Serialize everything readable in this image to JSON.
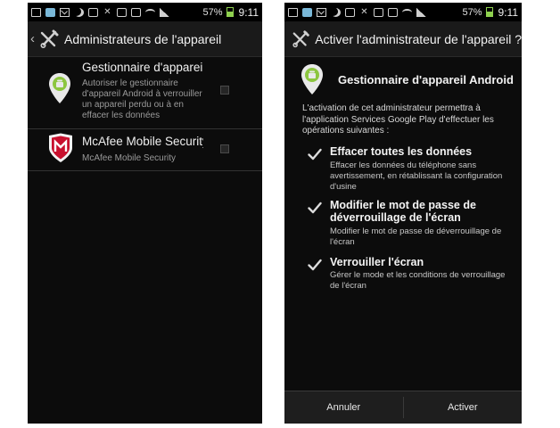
{
  "status_bar": {
    "battery": "57%",
    "time": "9:11"
  },
  "left_screen": {
    "title": "Administrateurs de l'appareil",
    "items": [
      {
        "title": "Gestionnaire d'appareil",
        "description": "Autoriser le gestionnaire d'appareil Android à verrouiller un appareil perdu ou à en effacer les données",
        "icon": "android-device-manager-icon",
        "checked": false
      },
      {
        "title": "McAfee Mobile Security",
        "description": "McAfee Mobile Security",
        "icon": "mcafee-shield-icon",
        "checked": false
      }
    ]
  },
  "right_screen": {
    "title": "Activer l'administrateur de l'appareil ?",
    "app_name": "Gestionnaire d'appareil Android",
    "intro": "L'activation de cet administrateur permettra à l'application Services Google Play d'effectuer les opérations suivantes :",
    "permissions": [
      {
        "title": "Effacer toutes les données",
        "description": "Effacer les données du téléphone sans avertissement, en rétablissant la configuration d'usine"
      },
      {
        "title": "Modifier le mot de passe de déverrouillage de l'écran",
        "description": "Modifier le mot de passe de déverrouillage de l'écran"
      },
      {
        "title": "Verrouiller l'écran",
        "description": "Gérer le mode et les conditions de verrouillage de l'écran"
      }
    ],
    "buttons": {
      "cancel": "Annuler",
      "activate": "Activer"
    }
  },
  "colors": {
    "background": "#0c0c0c",
    "android_green": "#8cc63f",
    "mcafee_red": "#c8102e",
    "battery_green": "#8fd14f"
  }
}
